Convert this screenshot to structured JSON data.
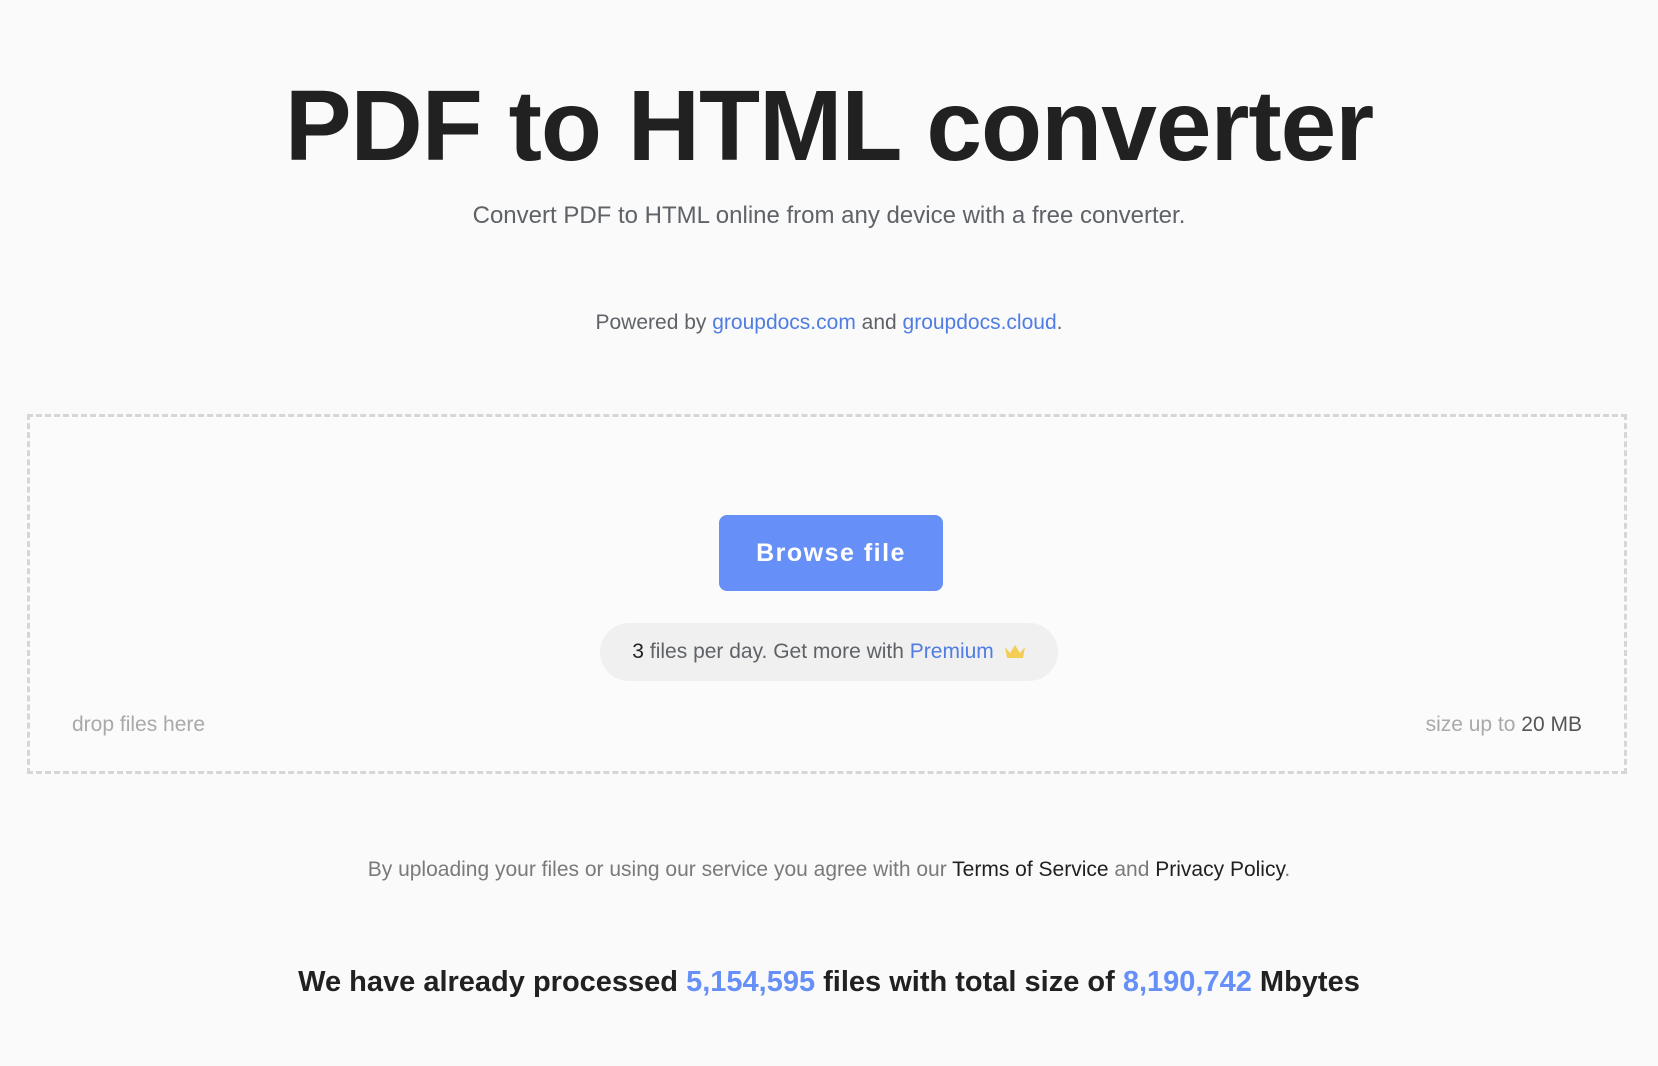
{
  "header": {
    "title": "PDF to HTML converter",
    "subtitle": "Convert PDF to HTML online from any device with a free converter."
  },
  "powered": {
    "prefix": "Powered by ",
    "link1": "groupdocs.com",
    "middle": " and ",
    "link2": "groupdocs.cloud",
    "suffix": "."
  },
  "dropzone": {
    "browse_label": "Browse file",
    "limit_count": "3",
    "limit_text": "files per day. Get more with ",
    "premium_label": "Premium",
    "premium_icon": "crown-icon",
    "drop_hint": "drop files here",
    "size_prefix": "size up to ",
    "size_value": "20 MB"
  },
  "terms": {
    "prefix": "By uploading your files or using our service you agree with our ",
    "tos_label": "Terms of Service",
    "middle": " and ",
    "privacy_label": "Privacy Policy",
    "suffix": "."
  },
  "stats": {
    "prefix": "We have already processed ",
    "files_count": "5,154,595",
    "middle": " files with total size of ",
    "size_total": "8,190,742",
    "suffix": " Mbytes"
  },
  "colors": {
    "accent": "#6690f7",
    "link": "#4f7de3",
    "crown": "#f3cd55"
  }
}
